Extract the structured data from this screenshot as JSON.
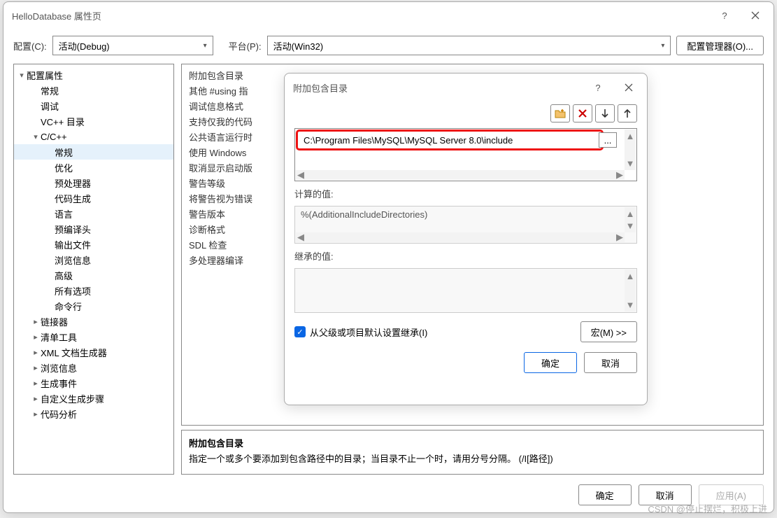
{
  "main": {
    "title": "HelloDatabase 属性页",
    "help_icon": "?",
    "config_label": "配置(C):",
    "config_value": "活动(Debug)",
    "platform_label": "平台(P):",
    "platform_value": "活动(Win32)",
    "mgr_btn": "配置管理器(O)..."
  },
  "tree": [
    {
      "label": "配置属性",
      "depth": 0,
      "exp": "▾"
    },
    {
      "label": "常规",
      "depth": 1,
      "exp": ""
    },
    {
      "label": "调试",
      "depth": 1,
      "exp": ""
    },
    {
      "label": "VC++ 目录",
      "depth": 1,
      "exp": ""
    },
    {
      "label": "C/C++",
      "depth": 1,
      "exp": "▾"
    },
    {
      "label": "常规",
      "depth": 2,
      "exp": "",
      "selected": true
    },
    {
      "label": "优化",
      "depth": 2,
      "exp": ""
    },
    {
      "label": "预处理器",
      "depth": 2,
      "exp": ""
    },
    {
      "label": "代码生成",
      "depth": 2,
      "exp": ""
    },
    {
      "label": "语言",
      "depth": 2,
      "exp": ""
    },
    {
      "label": "预编译头",
      "depth": 2,
      "exp": ""
    },
    {
      "label": "输出文件",
      "depth": 2,
      "exp": ""
    },
    {
      "label": "浏览信息",
      "depth": 2,
      "exp": ""
    },
    {
      "label": "高级",
      "depth": 2,
      "exp": ""
    },
    {
      "label": "所有选项",
      "depth": 2,
      "exp": ""
    },
    {
      "label": "命令行",
      "depth": 2,
      "exp": ""
    },
    {
      "label": "链接器",
      "depth": 1,
      "exp": "▸"
    },
    {
      "label": "清单工具",
      "depth": 1,
      "exp": "▸"
    },
    {
      "label": "XML 文档生成器",
      "depth": 1,
      "exp": "▸"
    },
    {
      "label": "浏览信息",
      "depth": 1,
      "exp": "▸"
    },
    {
      "label": "生成事件",
      "depth": 1,
      "exp": "▸"
    },
    {
      "label": "自定义生成步骤",
      "depth": 1,
      "exp": "▸"
    },
    {
      "label": "代码分析",
      "depth": 1,
      "exp": "▸"
    }
  ],
  "props": [
    "附加包含目录",
    "其他 #using 指",
    "调试信息格式",
    "支持仅我的代码",
    "公共语言运行时",
    "使用 Windows",
    "取消显示启动版",
    "警告等级",
    "将警告视为错误",
    "警告版本",
    "诊断格式",
    "SDL 检查",
    "多处理器编译"
  ],
  "desc": {
    "title": "附加包含目录",
    "text": "指定一个或多个要添加到包含路径中的目录；当目录不止一个时，请用分号分隔。    (/I[路径])"
  },
  "buttons": {
    "ok": "确定",
    "cancel": "取消",
    "apply": "应用(A)"
  },
  "dialog": {
    "title": "附加包含目录",
    "help_icon": "?",
    "path_value": "C:\\Program Files\\MySQL\\MySQL Server 8.0\\include",
    "browse": "...",
    "calc_label": "计算的值:",
    "calc_value": "%(AdditionalIncludeDirectories)",
    "inherit_label": "继承的值:",
    "inherit_chk": "从父级或项目默认设置继承(I)",
    "macro_btn": "宏(M) >>",
    "ok": "确定",
    "cancel": "取消"
  },
  "watermark": "CSDN @停止摆烂，积极上进"
}
